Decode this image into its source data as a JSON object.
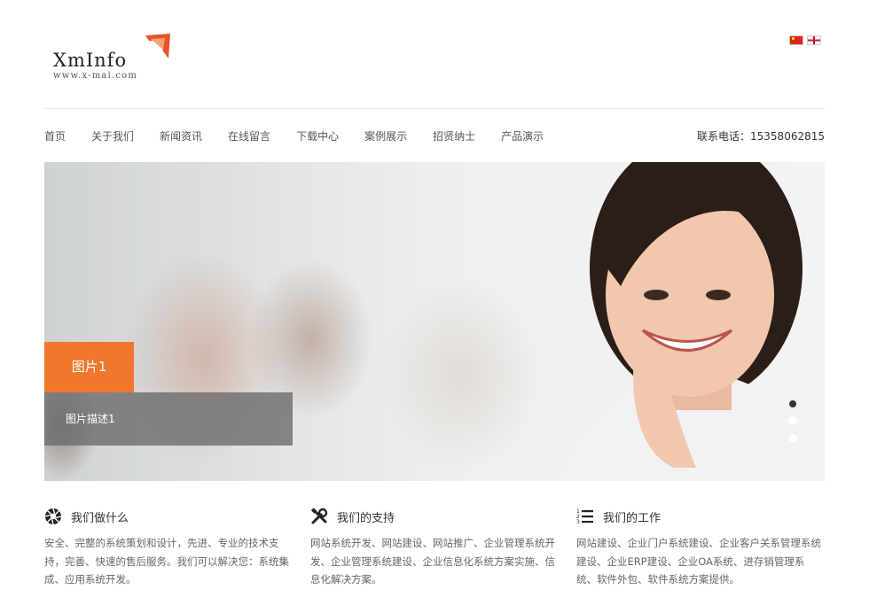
{
  "brand": {
    "name": "XmInfo",
    "url": "www.x-mai.com"
  },
  "languages": [
    {
      "icon": "china-flag-icon"
    },
    {
      "icon": "uk-flag-icon"
    }
  ],
  "nav": {
    "items": [
      "首页",
      "关于我们",
      "新闻资讯",
      "在线留言",
      "下载中心",
      "案例展示",
      "招贤纳士",
      "产品演示"
    ],
    "phone": "联系电话：15358062815"
  },
  "slider": {
    "title": "图片1",
    "description": "图片描述1",
    "slide_count": 3,
    "active_index": 0,
    "accent": "#f0782c"
  },
  "features": [
    {
      "icon": "aperture-icon",
      "title": "我们做什么",
      "text": "安全、完整的系统策划和设计，先进、专业的技术支持，完善、快速的售后服务。我们可以解决您：系统集成、应用系统开发。"
    },
    {
      "icon": "tools-icon",
      "title": "我们的支持",
      "text": "网站系统开发、网站建设、网站推广、企业管理系统开发、企业管理系统建设、企业信息化系统方案实施、信息化解决方案。"
    },
    {
      "icon": "numbered-list-icon",
      "title": "我们的工作",
      "text": "网站建设、企业门户系统建设、企业客户关系管理系统建设、企业ERP建设、企业OA系统、进存销管理系统、软件外包、软件系统方案提供。"
    }
  ]
}
